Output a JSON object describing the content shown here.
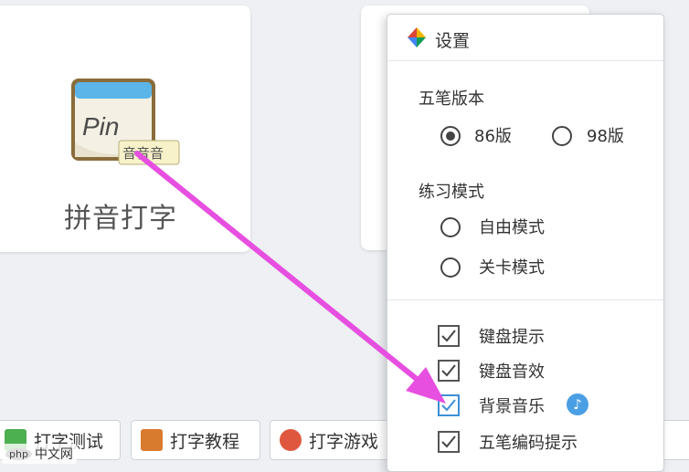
{
  "main": {
    "card_title": "拼音打字",
    "icon_text": "Pin",
    "icon_tag": "音音音"
  },
  "taskbar": {
    "buttons": [
      {
        "label": "打字测试",
        "icon": "typing-test-icon"
      },
      {
        "label": "打字教程",
        "icon": "tutorial-book-icon"
      },
      {
        "label": "打字游戏",
        "icon": "game-balloon-icon"
      }
    ]
  },
  "watermark": {
    "logo": "php",
    "text": "中文网"
  },
  "settings": {
    "title": "设置",
    "wubi_version": {
      "title": "五笔版本",
      "options": [
        {
          "label": "86版",
          "checked": true
        },
        {
          "label": "98版",
          "checked": false
        }
      ]
    },
    "practice_mode": {
      "title": "练习模式",
      "options": [
        {
          "label": "自由模式",
          "checked": false
        },
        {
          "label": "关卡模式",
          "checked": false
        }
      ]
    },
    "checkboxes": [
      {
        "label": "键盘提示",
        "checked": true
      },
      {
        "label": "键盘音效",
        "checked": true
      },
      {
        "label": "背景音乐",
        "checked": true,
        "has_music_icon": true
      },
      {
        "label": "五笔编码提示",
        "checked": true
      }
    ]
  },
  "colors": {
    "arrow": "#e64fe0",
    "accent": "#4a9fe4"
  }
}
